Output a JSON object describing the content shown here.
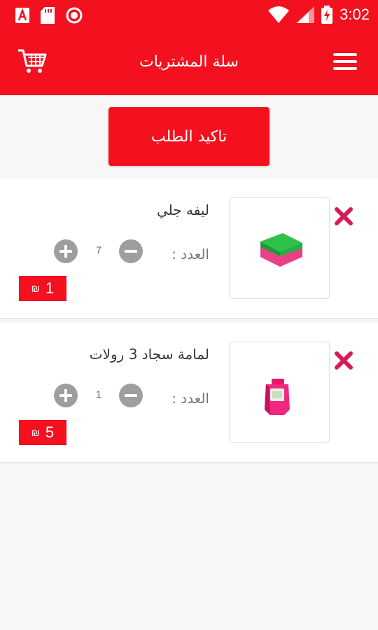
{
  "status_bar": {
    "time": "3:02",
    "icons": [
      "font-a-icon",
      "sd-card-icon",
      "record-icon",
      "wifi-icon",
      "signal-icon",
      "battery-charging-icon"
    ]
  },
  "app_bar": {
    "title": "سلة المشتريات",
    "left_icon": "cart-icon",
    "right_icon": "menu-icon"
  },
  "confirm_button": {
    "label": "تاكيد الطلب"
  },
  "items": [
    {
      "name": "ليفه جلي",
      "qty_label": "العدد :",
      "quantity": "7",
      "price": "1",
      "currency": "₪",
      "image": "sponge-image"
    },
    {
      "name": "لمامة سجاد 3 رولات",
      "qty_label": "العدد :",
      "quantity": "1",
      "price": "5",
      "currency": "₪",
      "image": "lint-roller-image"
    }
  ],
  "colors": {
    "primary": "#f3101f",
    "remove": "#d81b55",
    "stepper": "#9e9e9e"
  }
}
